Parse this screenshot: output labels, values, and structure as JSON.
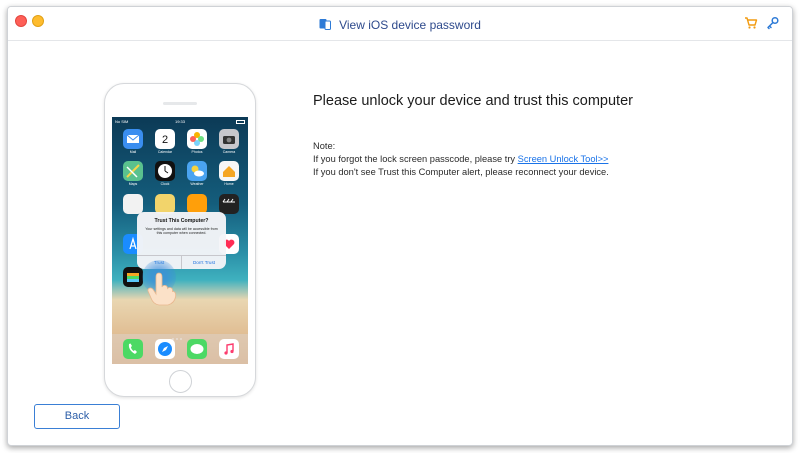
{
  "window": {
    "title": "View iOS device password",
    "accent": "#2e4a8c",
    "link_color": "#1a73e8"
  },
  "toolbar": {
    "icons": [
      "cart-icon",
      "key-icon"
    ]
  },
  "phone": {
    "status_carrier": "No SIM",
    "status_time": "19:33",
    "calendar_day": "2",
    "apps": [
      "Mail",
      "Calendar",
      "Photos",
      "Camera",
      "Maps",
      "Clock",
      "Weather",
      "Home"
    ],
    "alert": {
      "title": "Trust This Computer?",
      "message": "Your settings and data will be accessible from this computer when connected.",
      "trust_label": "Trust",
      "dont_trust_label": "Don't Trust"
    }
  },
  "main": {
    "heading": "Please unlock your device and trust this computer",
    "note_label": "Note:",
    "line1_prefix": "If you forgot the lock screen passcode, please try ",
    "line1_link": "Screen Unlock Tool>>",
    "line2": "If you don't see Trust this Computer alert, please reconnect your device."
  },
  "footer": {
    "back_label": "Back"
  }
}
